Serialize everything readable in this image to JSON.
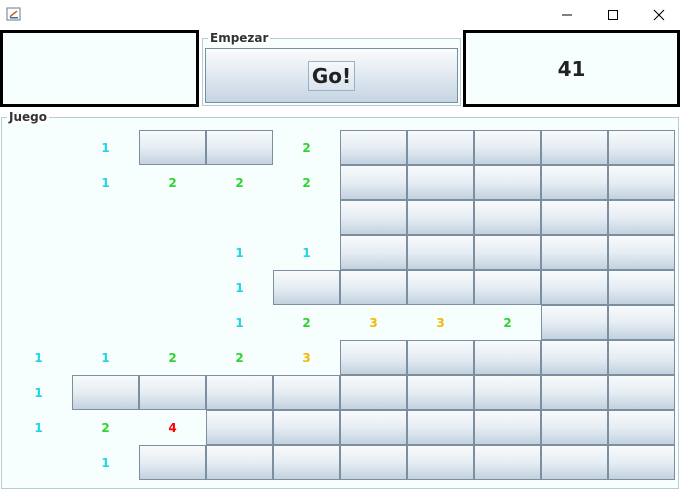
{
  "window": {
    "icon": "java-app-icon",
    "controls": [
      "minimize-icon",
      "maximize-icon",
      "close-icon"
    ]
  },
  "header": {
    "left_display": "",
    "start_group_label": "Empezar",
    "go_button_label": "Go!",
    "counter_value": "41"
  },
  "game": {
    "group_label": "Juego",
    "rows": 10,
    "cols": 10,
    "number_colors": {
      "1": "#22d3e6",
      "2": "#2ed52e",
      "3": "#f2b80a",
      "4": "#ff0000"
    },
    "grid": [
      [
        " ",
        "1",
        "#",
        "#",
        "2",
        "#",
        "#",
        "#",
        "#",
        "#"
      ],
      [
        " ",
        "1",
        "2",
        "2",
        "2",
        "#",
        "#",
        "#",
        "#",
        "#"
      ],
      [
        " ",
        " ",
        " ",
        " ",
        " ",
        "#",
        "#",
        "#",
        "#",
        "#"
      ],
      [
        " ",
        " ",
        " ",
        "1",
        "1",
        "#",
        "#",
        "#",
        "#",
        "#"
      ],
      [
        " ",
        " ",
        " ",
        "1",
        "#",
        "#",
        "#",
        "#",
        "#",
        "#"
      ],
      [
        " ",
        " ",
        " ",
        "1",
        "2",
        "3",
        "3",
        "2",
        "#",
        "#"
      ],
      [
        "1",
        "1",
        "2",
        "2",
        "3",
        "#",
        "#",
        "#",
        "#",
        "#"
      ],
      [
        "1",
        "#",
        "#",
        "#",
        "#",
        "#",
        "#",
        "#",
        "#",
        "#"
      ],
      [
        "1",
        "2",
        "4",
        "#",
        "#",
        "#",
        "#",
        "#",
        "#",
        "#"
      ],
      [
        " ",
        "1",
        "#",
        "#",
        "#",
        "#",
        "#",
        "#",
        "#",
        "#"
      ]
    ]
  }
}
